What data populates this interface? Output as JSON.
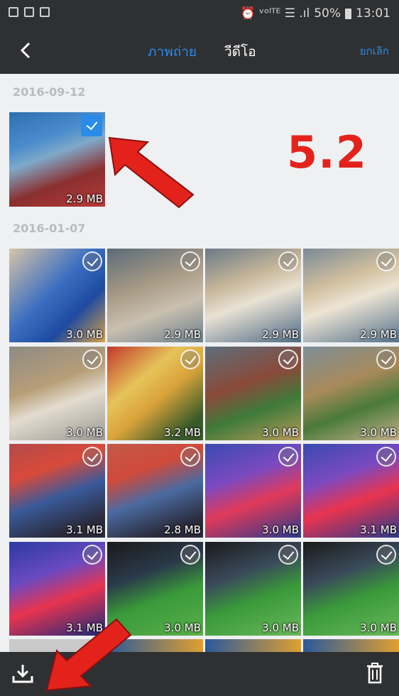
{
  "status_bar": {
    "right_text": "⏰ ᵛᵒˡᵀᴱ ☰ .ıl",
    "battery": "50%",
    "time": "13:01"
  },
  "app_bar": {
    "tab_photos": "ภาพถ่าย",
    "tab_videos": "วีดีโอ",
    "cancel": "ยกเลิก",
    "active_tab_color": "#2b8be8"
  },
  "groups": [
    {
      "date": "2016-09-12",
      "items": [
        {
          "size": "2.9 MB",
          "selected": true
        }
      ]
    },
    {
      "date": "2016-01-07",
      "items": [
        {
          "size": "3.0 MB"
        },
        {
          "size": "2.9 MB"
        },
        {
          "size": "2.9 MB"
        },
        {
          "size": "2.9 MB"
        },
        {
          "size": "3.0 MB"
        },
        {
          "size": "3.2 MB"
        },
        {
          "size": "3.0 MB"
        },
        {
          "size": "3.0 MB"
        },
        {
          "size": "3.1 MB"
        },
        {
          "size": "2.8 MB"
        },
        {
          "size": "3.0 MB"
        },
        {
          "size": "3.1 MB"
        },
        {
          "size": "3.1 MB"
        },
        {
          "size": "3.0 MB"
        },
        {
          "size": "3.0 MB"
        },
        {
          "size": "3.0 MB"
        }
      ]
    }
  ],
  "annotation": {
    "label": "5.2",
    "color": "#e3231b"
  },
  "bottom_bar": {
    "download_icon": "download-icon",
    "delete_icon": "trash-icon"
  }
}
